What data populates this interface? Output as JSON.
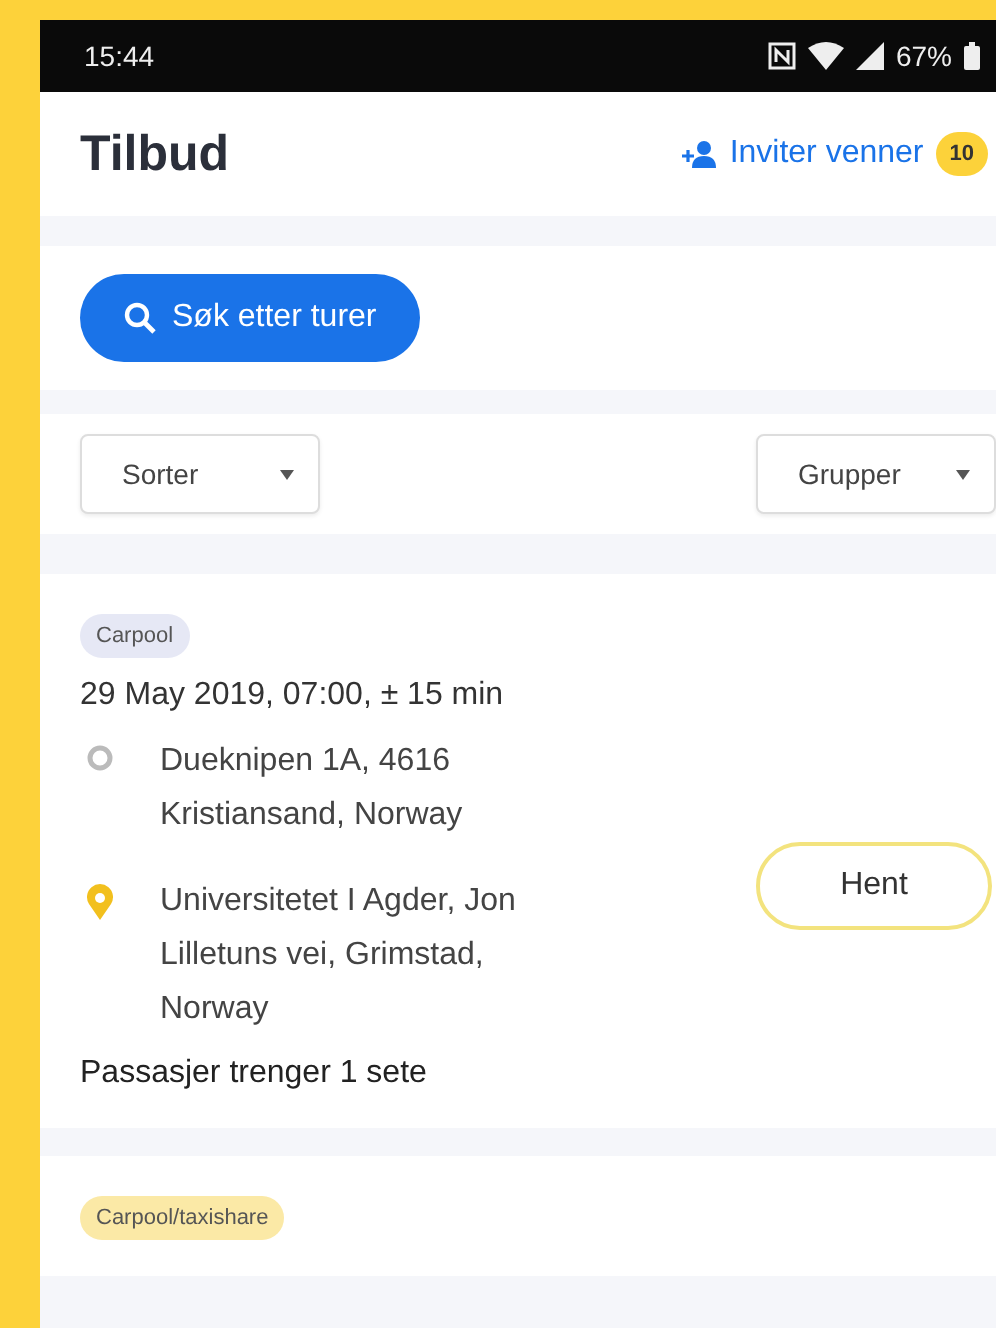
{
  "status_bar": {
    "time": "15:44",
    "battery": "67%"
  },
  "header": {
    "title": "Tilbud",
    "invite": "Inviter venner",
    "invite_count": "10"
  },
  "search_button": "Søk etter turer",
  "sort": {
    "label": "Sorter"
  },
  "group": {
    "label": "Grupper"
  },
  "offers": [
    {
      "tag": "Carpool",
      "color": "#e6e8f5",
      "date": "29 May 2019, 07:00, ± 15 min",
      "from": "Dueknipen 1A, 4616 Kristiansand, Norway",
      "to": "Universitetet I Agder, Jon Lilletuns vei, Grimstad, Norway",
      "seats": "Passasjer trenger 1 sete",
      "action": "Hent"
    },
    {
      "tag": "Carpool/taxishare",
      "color": "#fbe9a6"
    }
  ]
}
